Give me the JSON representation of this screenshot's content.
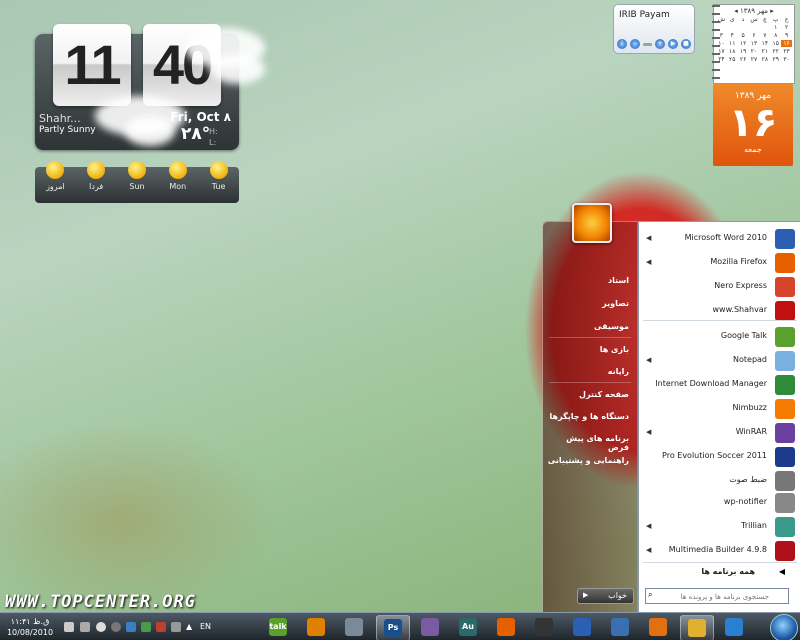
{
  "clock": {
    "hours": "11",
    "minutes": "40",
    "city": "Shahr...",
    "condition": "Partly Sunny",
    "date": "Fri, Oct ۸",
    "temp": "۲۸°",
    "high_label": "H:",
    "low_label": "L:"
  },
  "forecast": [
    {
      "day": "امروز"
    },
    {
      "day": "فردا"
    },
    {
      "day": "Sun"
    },
    {
      "day": "Mon"
    },
    {
      "day": "Tue"
    }
  ],
  "media": {
    "title": "IRIB Payam"
  },
  "calendar": {
    "header": "مهر ۱۳۸۹",
    "grid": [
      "ش",
      "ی",
      "د",
      "س",
      "چ",
      "پ",
      "ج",
      "",
      "",
      "",
      "",
      "",
      "۱",
      "۲",
      "۳",
      "۴",
      "۵",
      "۶",
      "۷",
      "۸",
      "۹",
      "۱۰",
      "۱۱",
      "۱۲",
      "۱۳",
      "۱۴",
      "۱۵",
      "۱۶",
      "۱۷",
      "۱۸",
      "۱۹",
      "۲۰",
      "۲۱",
      "۲۲",
      "۲۳",
      "۲۴",
      "۲۵",
      "۲۶",
      "۲۷",
      "۲۸",
      "۲۹",
      "۳۰"
    ],
    "today": "۱۶",
    "big_month": "مهر ۱۳۸۹",
    "big_day": "۱۶",
    "big_weekday": "جمعه"
  },
  "start_menu": {
    "places": [
      "استاد",
      "تصاویر",
      "موسیقی",
      "بازی ها",
      "رایانه",
      "صفحه کنترل",
      "دستگاه ها و چاپگرها",
      "برنامه های پیش فرض",
      "راهنمایی و پشتیبانی"
    ],
    "programs": [
      {
        "label": "Microsoft Word 2010",
        "arrow": true,
        "icon": "word-icon",
        "color": "#2b5fb3"
      },
      {
        "label": "Mozilla Firefox",
        "arrow": true,
        "icon": "firefox-icon",
        "color": "#e66000"
      },
      {
        "label": "Nero Express",
        "arrow": false,
        "icon": "nero-icon",
        "color": "#d8432c"
      },
      {
        "label": "www.Shahvar",
        "arrow": false,
        "icon": "shahvar-icon",
        "color": "#c01010"
      },
      {
        "label": "Google Talk",
        "arrow": false,
        "icon": "gtalk-icon",
        "color": "#5aa02c"
      },
      {
        "label": "Notepad",
        "arrow": true,
        "icon": "notepad-icon",
        "color": "#7ab0e0"
      },
      {
        "label": "Internet Download Manager",
        "arrow": false,
        "icon": "idm-icon",
        "color": "#2e8b3a"
      },
      {
        "label": "Nimbuzz",
        "arrow": false,
        "icon": "nimbuzz-icon",
        "color": "#f57c00"
      },
      {
        "label": "WinRAR",
        "arrow": true,
        "icon": "winrar-icon",
        "color": "#6b3fa0"
      },
      {
        "label": "Pro Evolution Soccer 2011",
        "arrow": false,
        "icon": "pes-icon",
        "color": "#1c3b8a"
      },
      {
        "label": "ضبط صوت",
        "arrow": false,
        "icon": "microphone-icon",
        "color": "#777777"
      },
      {
        "label": "wp-notifier",
        "arrow": false,
        "icon": "wordpress-icon",
        "color": "#888888"
      },
      {
        "label": "Trillian",
        "arrow": true,
        "icon": "trillian-icon",
        "color": "#3a9a8a"
      },
      {
        "label": "Multimedia Builder 4.9.8",
        "arrow": true,
        "icon": "mmb-icon",
        "color": "#b0101a"
      }
    ],
    "all_programs": "همه برنامه ها",
    "search_placeholder": "جستجوی برنامه ها و پرونده ها",
    "shutdown": "خواب"
  },
  "watermark": "WWW.TOPCENTER.ORG",
  "taskbar": {
    "time": "۱۱:۴۱ ق.ظ",
    "date": "10/08/2010",
    "lang": "EN",
    "buttons": [
      {
        "icon": "gtalk-icon",
        "text": "talk",
        "color": "#5aa02c"
      },
      {
        "icon": "idm-icon",
        "text": "",
        "color": "#e08000"
      },
      {
        "icon": "window-icon",
        "text": "",
        "color": "#7a8a99"
      },
      {
        "icon": "photoshop-icon",
        "text": "Ps",
        "color": "#1b4f8a"
      },
      {
        "icon": "disc-icon",
        "text": "",
        "color": "#7a5aa0"
      },
      {
        "icon": "audition-icon",
        "text": "Au",
        "color": "#2a6a6a"
      },
      {
        "icon": "firefox-icon",
        "text": "",
        "color": "#e66000"
      },
      {
        "icon": "horse-icon",
        "text": "",
        "color": "#333333"
      },
      {
        "icon": "outlook-icon",
        "text": "",
        "color": "#2b5fb3"
      },
      {
        "icon": "monitor-icon",
        "text": "",
        "color": "#3a6fb0"
      },
      {
        "icon": "media-player-icon",
        "text": "",
        "color": "#e07010"
      },
      {
        "icon": "folder-icon",
        "text": "",
        "color": "#e0b030"
      },
      {
        "icon": "ie-icon",
        "text": "",
        "color": "#2a80d0"
      }
    ]
  }
}
